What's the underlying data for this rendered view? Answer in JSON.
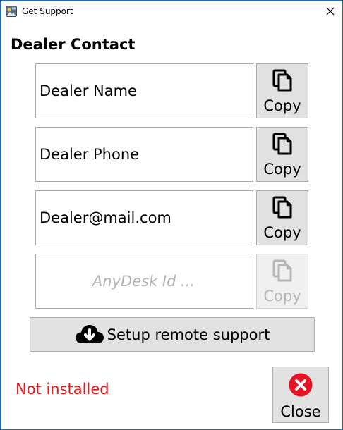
{
  "window": {
    "title": "Get Support"
  },
  "heading": "Dealer Contact",
  "fields": [
    {
      "value": "Dealer Name",
      "placeholder": ""
    },
    {
      "value": "Dealer Phone",
      "placeholder": ""
    },
    {
      "value": "Dealer@mail.com",
      "placeholder": ""
    },
    {
      "value": "",
      "placeholder": "AnyDesk Id ..."
    }
  ],
  "copy_buttons": [
    {
      "label": "Copy",
      "enabled": true
    },
    {
      "label": "Copy",
      "enabled": true
    },
    {
      "label": "Copy",
      "enabled": true
    },
    {
      "label": "Copy",
      "enabled": false
    }
  ],
  "setup_button": {
    "label": "Setup remote support"
  },
  "status_text": "Not installed",
  "close_button": {
    "label": "Close"
  },
  "colors": {
    "window_border": "#1c6bc9",
    "status": "#e81818",
    "close_icon": "#e81123",
    "button_bg": "#e1e1e1"
  }
}
